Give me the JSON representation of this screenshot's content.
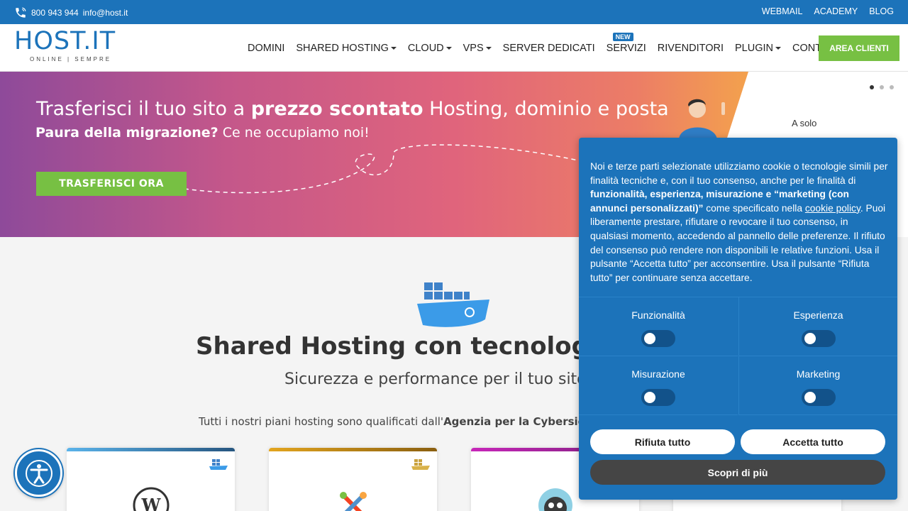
{
  "topbar": {
    "phone": "800 943 944",
    "email": "info@host.it",
    "links": [
      "WEBMAIL",
      "ACADEMY",
      "BLOG"
    ]
  },
  "logo": {
    "text": "HOST.IT",
    "tagline": "ONLINE | SEMPRE"
  },
  "nav": {
    "items": [
      {
        "label": "DOMINI"
      },
      {
        "label": "SHARED HOSTING"
      },
      {
        "label": "CLOUD"
      },
      {
        "label": "VPS"
      },
      {
        "label": "SERVER DEDICATI"
      },
      {
        "label": "SERVIZI"
      },
      {
        "label": "RIVENDITORI"
      },
      {
        "label": "PLUGIN"
      },
      {
        "label": "CONTATTI"
      }
    ],
    "badge": "NEW",
    "area_button": "AREA CLIENTI"
  },
  "hero": {
    "title_pre": "Trasferisci il tuo sito a ",
    "title_bold": "prezzo scontato",
    "title_post": " Hosting, dominio e posta",
    "sub_bold": "Paura della migrazione?",
    "sub_rest": " Ce ne occupiamo noi!",
    "cta": "TRASFERISCI ORA",
    "price_prefix": "A solo"
  },
  "section": {
    "title": "Shared Hosting con tecnologia",
    "subtitle": "Sicurezza e performance per il tuo sito",
    "note_pre": "Tutti i nostri piani hosting sono qualificati dall'",
    "note_bold": "Agenzia per la Cybersicurezza"
  },
  "colors": {
    "brand": "#1c73ba",
    "accent_green": "#77c043",
    "card_bars": [
      "#4aa3e0",
      "#d69a1a",
      "#c02a9a"
    ]
  },
  "cookie": {
    "text_a": "Noi e terze parti selezionate utilizziamo cookie o tecnologie simili per finalità tecniche e, con il tuo consenso, anche per le finalità di ",
    "text_bold": "funzionalità, esperienza, misurazione e “marketing (con annunci personalizzati)”",
    "text_b": " come specificato nella ",
    "link": "cookie policy",
    "text_c": ". Puoi liberamente prestare, rifiutare o revocare il tuo consenso, in qualsiasi momento, accedendo al pannello delle preferenze. Il rifiuto del consenso può rendere non disponibili le relative funzioni. Usa il pulsante “Accetta tutto” per acconsentire. Usa il pulsante “Rifiuta tutto” per continuare senza accettare.",
    "toggles": [
      "Funzionalità",
      "Esperienza",
      "Misurazione",
      "Marketing"
    ],
    "reject": "Rifiuta tutto",
    "accept": "Accetta tutto",
    "more": "Scopri di più"
  }
}
